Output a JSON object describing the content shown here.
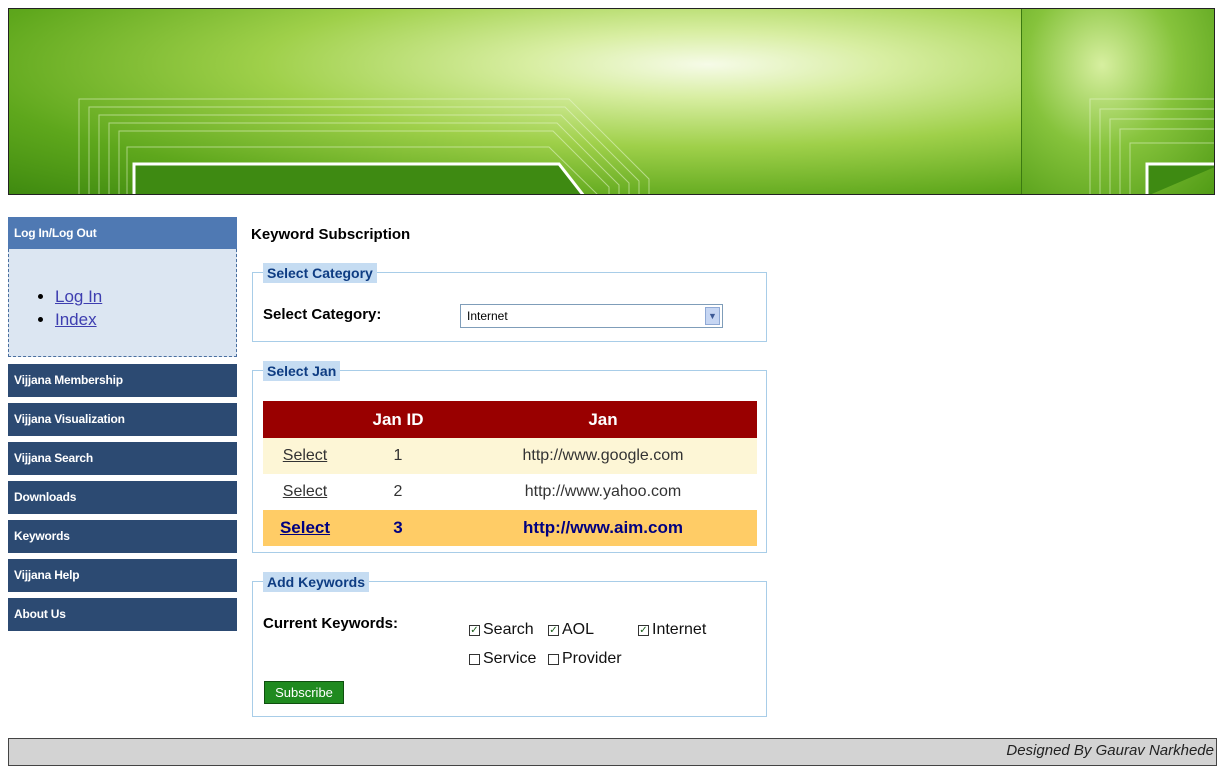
{
  "sidebar": {
    "login_header": "Log In/Log Out",
    "links": [
      "Log In",
      "Index"
    ],
    "items": [
      "Vijjana Membership",
      "Vijjana Visualization",
      "Vijjana Search",
      "Downloads",
      "Keywords",
      "Vijjana Help",
      "About Us"
    ]
  },
  "main": {
    "title": "Keyword Subscription",
    "category": {
      "legend": "Select Category",
      "label": "Select Category:",
      "selected": "Internet"
    },
    "jan": {
      "legend": "Select Jan",
      "headers": [
        "",
        "Jan ID",
        "Jan"
      ],
      "rows": [
        {
          "action": "Select",
          "id": "1",
          "url": "http://www.google.com"
        },
        {
          "action": "Select",
          "id": "2",
          "url": "http://www.yahoo.com"
        },
        {
          "action": "Select",
          "id": "3",
          "url": "http://www.aim.com"
        }
      ]
    },
    "keywords": {
      "legend": "Add Keywords",
      "label": "Current Keywords:",
      "items": [
        {
          "name": "Search",
          "checked": true
        },
        {
          "name": "AOL",
          "checked": true
        },
        {
          "name": "Internet",
          "checked": true
        },
        {
          "name": "Service",
          "checked": false
        },
        {
          "name": "Provider",
          "checked": false
        }
      ],
      "button": "Subscribe"
    }
  },
  "footer": {
    "credit": "Designed By Gaurav Narkhede"
  }
}
